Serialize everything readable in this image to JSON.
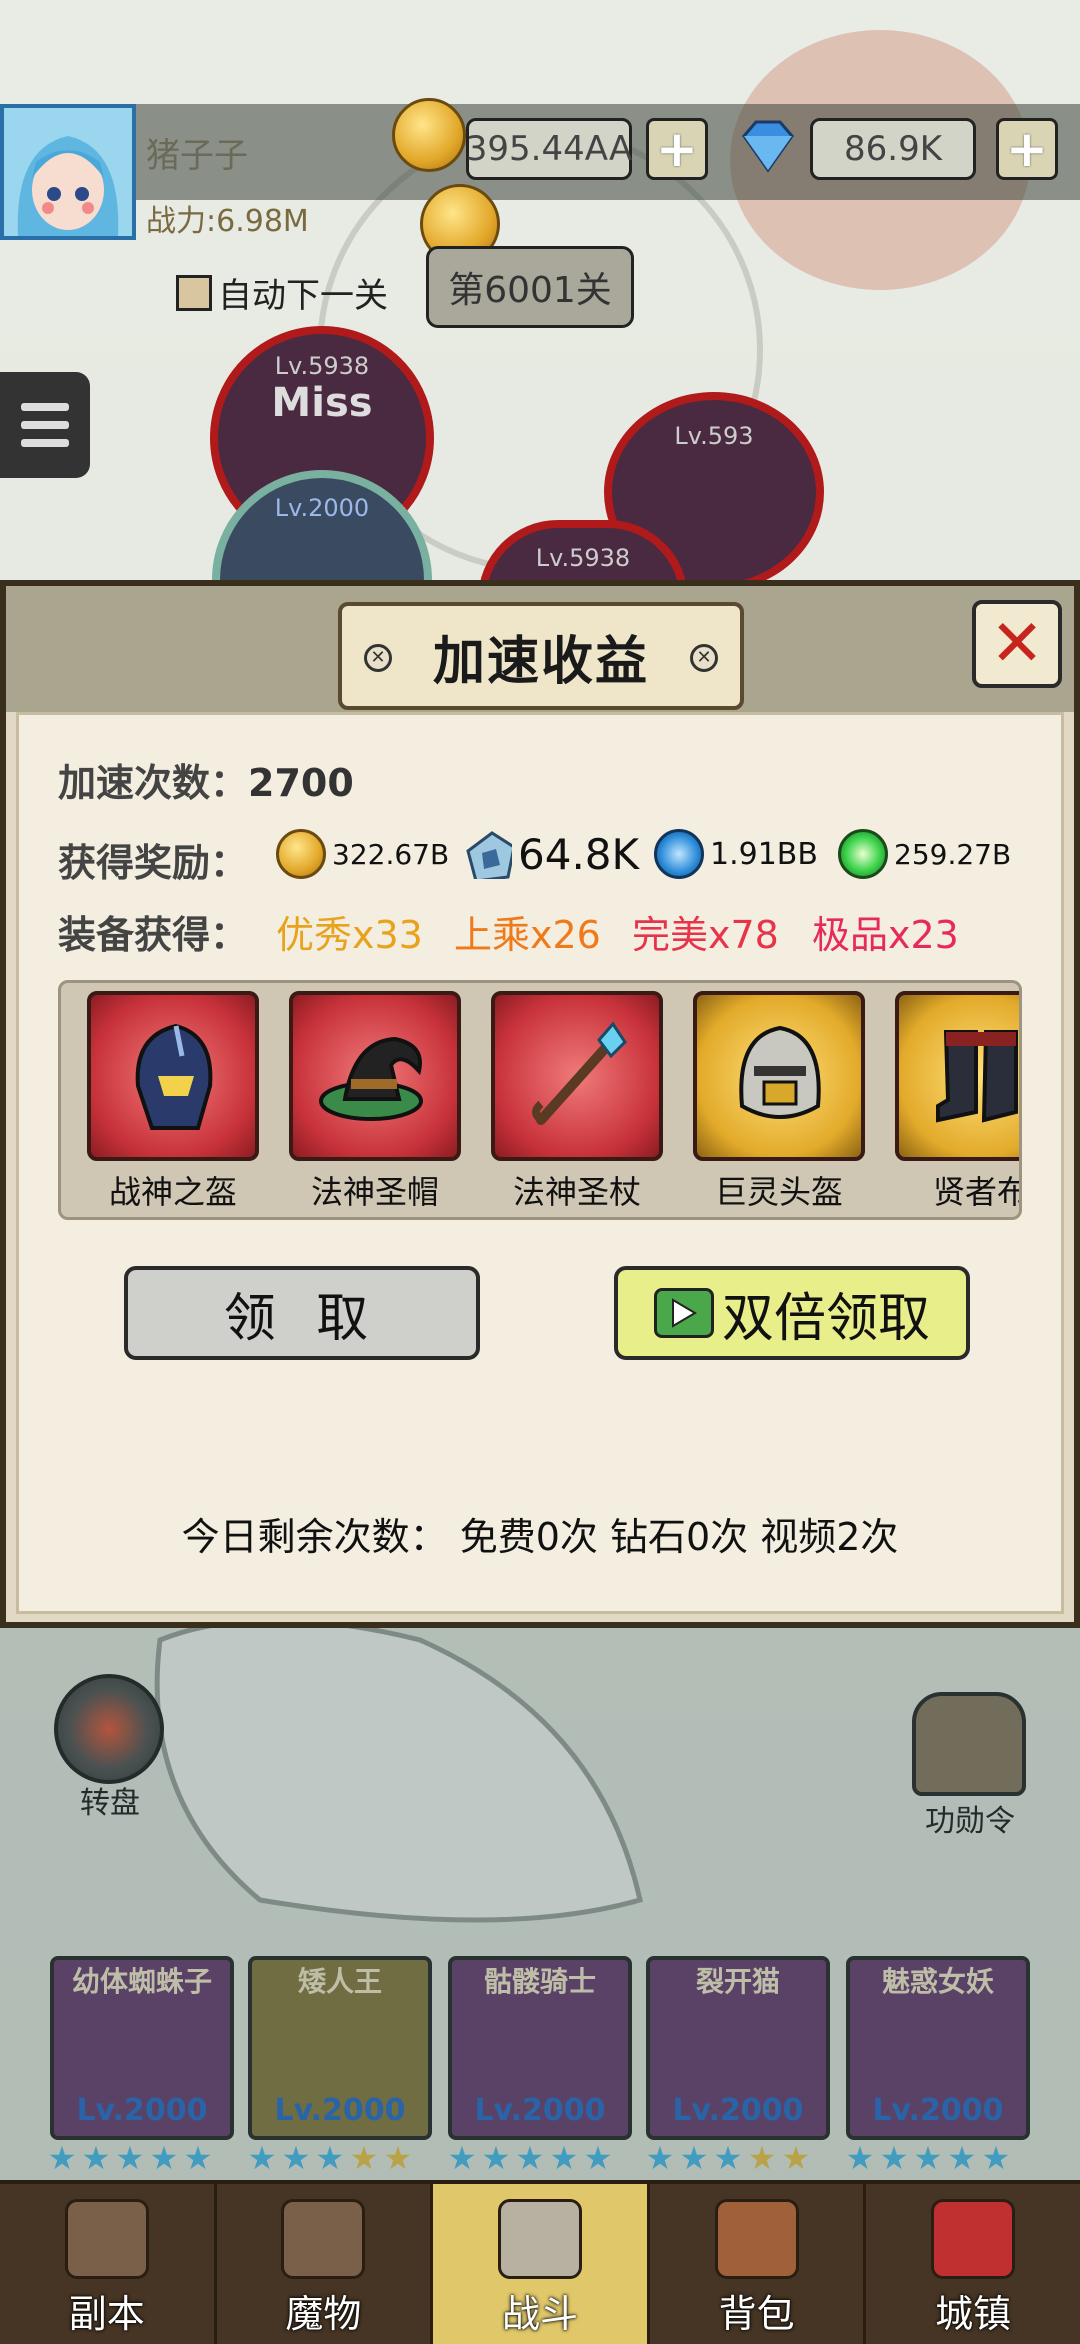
{
  "hud": {
    "player_name": "猪子子",
    "power": "战力:6.98M",
    "gold": "395.44AA",
    "diamonds": "86.9K",
    "plus": "+",
    "auto_next_label": "自动下一关",
    "stage": "第6001关"
  },
  "enemies": [
    {
      "level": "Lv.5938",
      "status": "Miss"
    },
    {
      "level": "Lv.2000"
    },
    {
      "level": "Lv.593"
    },
    {
      "level": "Lv.5938"
    }
  ],
  "dialog": {
    "title": "加速收益",
    "close": "✕",
    "speedup_count_label": "加速次数：",
    "speedup_count": "2700",
    "rewards_label": "获得奖励：",
    "rewards": [
      {
        "icon": "gold-coin-icon",
        "value": "322.67B"
      },
      {
        "icon": "blue-crystal-icon",
        "value": "64.8K"
      },
      {
        "icon": "blue-orb-icon",
        "value": "1.91BB"
      },
      {
        "icon": "green-orb-icon",
        "value": "259.27B"
      }
    ],
    "equipment_label": "装备获得：",
    "equipment_quality": [
      {
        "text": "优秀x33",
        "color": "#e8a21c"
      },
      {
        "text": "上乘x26",
        "color": "#f07a1a"
      },
      {
        "text": "完美x78",
        "color": "#e8344a"
      },
      {
        "text": "极品x23",
        "color": "#e82a5a"
      }
    ],
    "items": [
      {
        "name": "战神之盔",
        "rarity": "red",
        "icon": "helmet-icon"
      },
      {
        "name": "法神圣帽",
        "rarity": "red",
        "icon": "wizard-hat-icon"
      },
      {
        "name": "法神圣杖",
        "rarity": "red",
        "icon": "staff-icon"
      },
      {
        "name": "巨灵头盔",
        "rarity": "gold",
        "icon": "knight-helmet-icon"
      },
      {
        "name": "贤者布",
        "rarity": "gold",
        "icon": "boots-icon"
      }
    ],
    "claim_label": "领 取",
    "double_claim_label": "双倍领取",
    "remaining_text": "今日剩余次数：  免费0次   钻石0次   视频2次"
  },
  "side": {
    "wheel_label": "转盘",
    "merit_label": "功勋令"
  },
  "heroes": [
    {
      "name": "幼体蜘蛛子",
      "level": "Lv.2000"
    },
    {
      "name": "矮人王",
      "level": "Lv.2000"
    },
    {
      "name": "骷髅骑士",
      "level": "Lv.2000"
    },
    {
      "name": "裂开猫",
      "level": "Lv.2000"
    },
    {
      "name": "魅惑女妖",
      "level": "Lv.2000"
    }
  ],
  "nav": [
    {
      "label": "副本",
      "active": false
    },
    {
      "label": "魔物",
      "active": false
    },
    {
      "label": "战斗",
      "active": true
    },
    {
      "label": "背包",
      "active": false
    },
    {
      "label": "城镇",
      "active": false
    }
  ]
}
